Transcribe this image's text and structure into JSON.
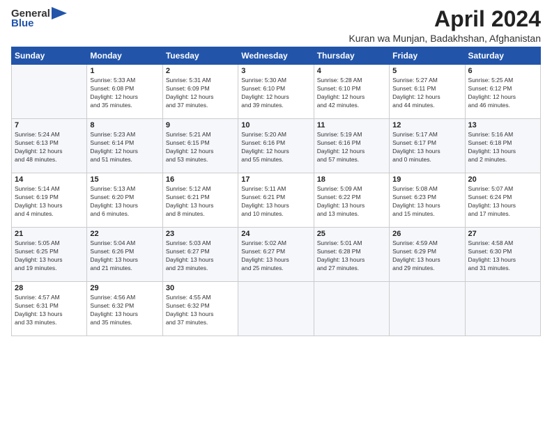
{
  "logo": {
    "general": "General",
    "blue": "Blue",
    "icon": "▶"
  },
  "title": "April 2024",
  "subtitle": "Kuran wa Munjan, Badakhshan, Afghanistan",
  "days_of_week": [
    "Sunday",
    "Monday",
    "Tuesday",
    "Wednesday",
    "Thursday",
    "Friday",
    "Saturday"
  ],
  "weeks": [
    [
      {
        "day": "",
        "info": ""
      },
      {
        "day": "1",
        "info": "Sunrise: 5:33 AM\nSunset: 6:08 PM\nDaylight: 12 hours\nand 35 minutes."
      },
      {
        "day": "2",
        "info": "Sunrise: 5:31 AM\nSunset: 6:09 PM\nDaylight: 12 hours\nand 37 minutes."
      },
      {
        "day": "3",
        "info": "Sunrise: 5:30 AM\nSunset: 6:10 PM\nDaylight: 12 hours\nand 39 minutes."
      },
      {
        "day": "4",
        "info": "Sunrise: 5:28 AM\nSunset: 6:10 PM\nDaylight: 12 hours\nand 42 minutes."
      },
      {
        "day": "5",
        "info": "Sunrise: 5:27 AM\nSunset: 6:11 PM\nDaylight: 12 hours\nand 44 minutes."
      },
      {
        "day": "6",
        "info": "Sunrise: 5:25 AM\nSunset: 6:12 PM\nDaylight: 12 hours\nand 46 minutes."
      }
    ],
    [
      {
        "day": "7",
        "info": "Sunrise: 5:24 AM\nSunset: 6:13 PM\nDaylight: 12 hours\nand 48 minutes."
      },
      {
        "day": "8",
        "info": "Sunrise: 5:23 AM\nSunset: 6:14 PM\nDaylight: 12 hours\nand 51 minutes."
      },
      {
        "day": "9",
        "info": "Sunrise: 5:21 AM\nSunset: 6:15 PM\nDaylight: 12 hours\nand 53 minutes."
      },
      {
        "day": "10",
        "info": "Sunrise: 5:20 AM\nSunset: 6:16 PM\nDaylight: 12 hours\nand 55 minutes."
      },
      {
        "day": "11",
        "info": "Sunrise: 5:19 AM\nSunset: 6:16 PM\nDaylight: 12 hours\nand 57 minutes."
      },
      {
        "day": "12",
        "info": "Sunrise: 5:17 AM\nSunset: 6:17 PM\nDaylight: 13 hours\nand 0 minutes."
      },
      {
        "day": "13",
        "info": "Sunrise: 5:16 AM\nSunset: 6:18 PM\nDaylight: 13 hours\nand 2 minutes."
      }
    ],
    [
      {
        "day": "14",
        "info": "Sunrise: 5:14 AM\nSunset: 6:19 PM\nDaylight: 13 hours\nand 4 minutes."
      },
      {
        "day": "15",
        "info": "Sunrise: 5:13 AM\nSunset: 6:20 PM\nDaylight: 13 hours\nand 6 minutes."
      },
      {
        "day": "16",
        "info": "Sunrise: 5:12 AM\nSunset: 6:21 PM\nDaylight: 13 hours\nand 8 minutes."
      },
      {
        "day": "17",
        "info": "Sunrise: 5:11 AM\nSunset: 6:21 PM\nDaylight: 13 hours\nand 10 minutes."
      },
      {
        "day": "18",
        "info": "Sunrise: 5:09 AM\nSunset: 6:22 PM\nDaylight: 13 hours\nand 13 minutes."
      },
      {
        "day": "19",
        "info": "Sunrise: 5:08 AM\nSunset: 6:23 PM\nDaylight: 13 hours\nand 15 minutes."
      },
      {
        "day": "20",
        "info": "Sunrise: 5:07 AM\nSunset: 6:24 PM\nDaylight: 13 hours\nand 17 minutes."
      }
    ],
    [
      {
        "day": "21",
        "info": "Sunrise: 5:05 AM\nSunset: 6:25 PM\nDaylight: 13 hours\nand 19 minutes."
      },
      {
        "day": "22",
        "info": "Sunrise: 5:04 AM\nSunset: 6:26 PM\nDaylight: 13 hours\nand 21 minutes."
      },
      {
        "day": "23",
        "info": "Sunrise: 5:03 AM\nSunset: 6:27 PM\nDaylight: 13 hours\nand 23 minutes."
      },
      {
        "day": "24",
        "info": "Sunrise: 5:02 AM\nSunset: 6:27 PM\nDaylight: 13 hours\nand 25 minutes."
      },
      {
        "day": "25",
        "info": "Sunrise: 5:01 AM\nSunset: 6:28 PM\nDaylight: 13 hours\nand 27 minutes."
      },
      {
        "day": "26",
        "info": "Sunrise: 4:59 AM\nSunset: 6:29 PM\nDaylight: 13 hours\nand 29 minutes."
      },
      {
        "day": "27",
        "info": "Sunrise: 4:58 AM\nSunset: 6:30 PM\nDaylight: 13 hours\nand 31 minutes."
      }
    ],
    [
      {
        "day": "28",
        "info": "Sunrise: 4:57 AM\nSunset: 6:31 PM\nDaylight: 13 hours\nand 33 minutes."
      },
      {
        "day": "29",
        "info": "Sunrise: 4:56 AM\nSunset: 6:32 PM\nDaylight: 13 hours\nand 35 minutes."
      },
      {
        "day": "30",
        "info": "Sunrise: 4:55 AM\nSunset: 6:32 PM\nDaylight: 13 hours\nand 37 minutes."
      },
      {
        "day": "",
        "info": ""
      },
      {
        "day": "",
        "info": ""
      },
      {
        "day": "",
        "info": ""
      },
      {
        "day": "",
        "info": ""
      }
    ]
  ]
}
